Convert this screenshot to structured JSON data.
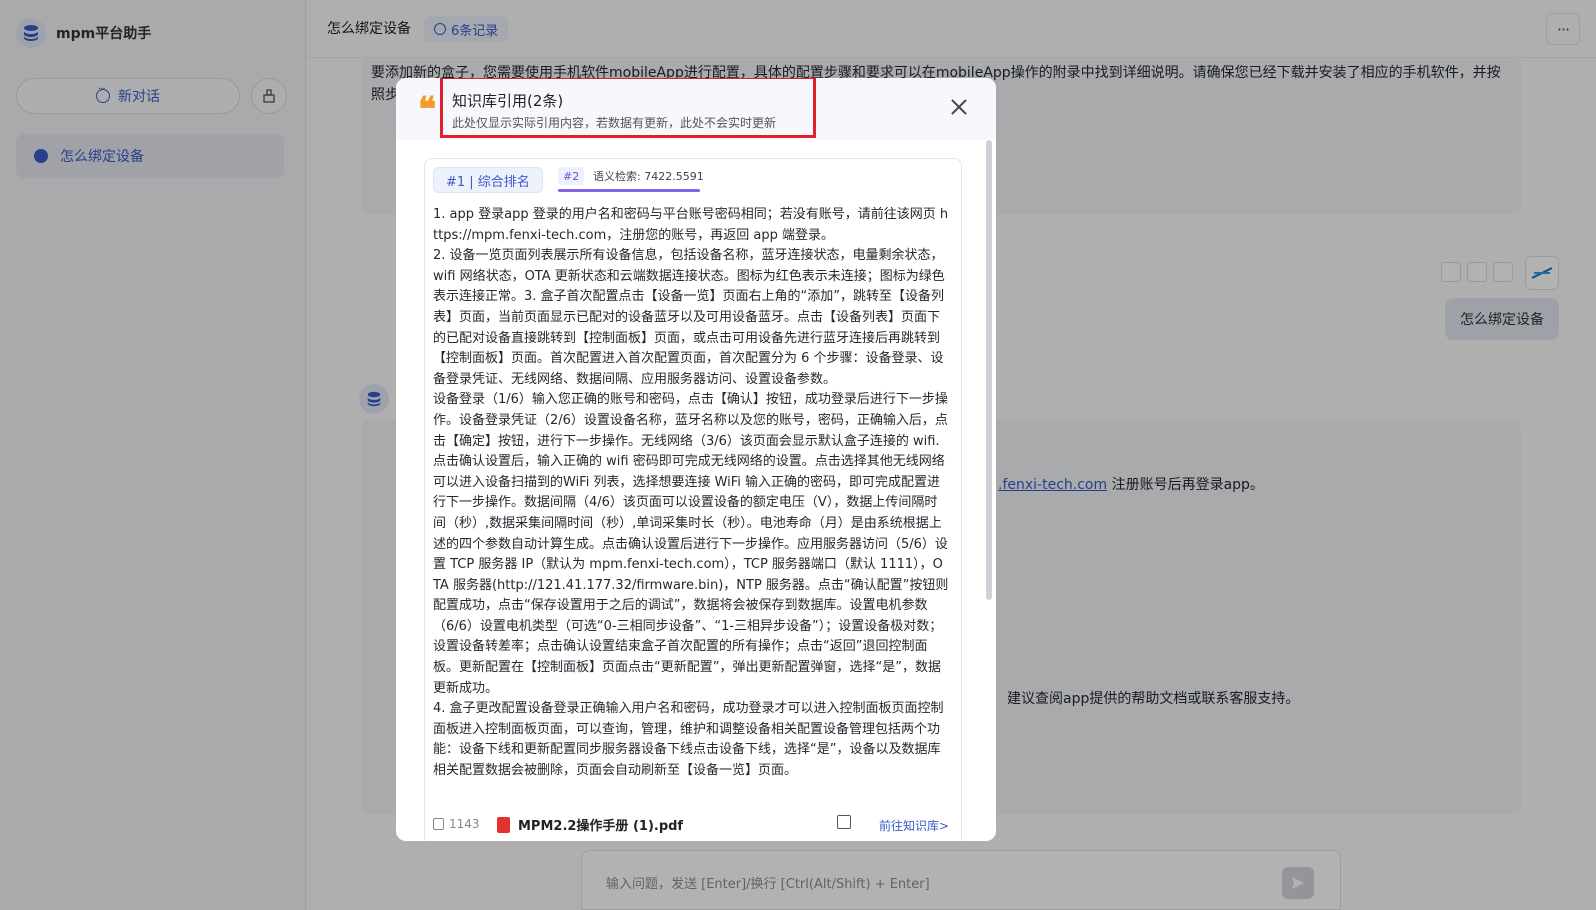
{
  "app": {
    "name": "mpm平台助手"
  },
  "sidebar": {
    "new_chat_label": "新对话",
    "history": [
      {
        "label": "怎么绑定设备"
      }
    ]
  },
  "header": {
    "title": "怎么绑定设备",
    "records_label": "6条记录",
    "more_label": "···"
  },
  "chat": {
    "bg_line1": "要添加新的盒子，您需要使用手机软件mobileApp进行配置，具体的配置步骤和要求可以在mobileApp操作的附录中找到详细说明。请确保您已经下载并安装了相应的手机软件，并按",
    "bg_line2": "照步",
    "user_message": "怎么绑定设备",
    "bg_link_text": ".fenxi-tech.com",
    "bg_after_link": "注册账号后再登录app。",
    "bg_help": "建议查阅app提供的帮助文档或联系客服支持。"
  },
  "input": {
    "placeholder": "输入问题，发送 [Enter]/换行 [Ctrl(Alt/Shift) + Enter]"
  },
  "modal": {
    "title": "知识库引用(2条)",
    "subtitle": "此处仅显示实际引用内容，若数据有更新，此处不会实时更新",
    "quote_mark": "❝",
    "reference": {
      "rank_tag": "#1 | 综合排名",
      "semantic_tag": "#2",
      "semantic_label": "语义检索: 7422.5591",
      "paragraphs": [
        "1. app 登录app 登录的用户名和密码与平台账号密码相同；若没有账号，请前往该网页 https://mpm.fenxi-tech.com，注册您的账号，再返回 app 端登录。",
        "2. 设备一览页面列表展示所有设备信息，包括设备名称，蓝牙连接状态，电量剩余状态，wifi 网络状态，OTA 更新状态和云端数据连接状态。图标为红色表示未连接；图标为绿色表示连接正常。3. 盒子首次配置点击【设备一览】页面右上角的“添加”，跳转至【设备列表】页面，当前页面显示已配对的设备蓝牙以及可用设备蓝牙。点击【设备列表】页面下的已配对设备直接跳转到【控制面板】页面，或点击可用设备先进行蓝牙连接后再跳转到【控制面板】页面。首次配置进入首次配置页面，首次配置分为 6 个步骤：设备登录、设备登录凭证、无线网络、数据间隔、应用服务器访问、设置设备参数。",
        "设备登录（1/6）输入您正确的账号和密码，点击【确认】按钮，成功登录后进行下一步操作。设备登录凭证（2/6）设置设备名称，蓝牙名称以及您的账号，密码，正确输入后，点击【确定】按钮，进行下一步操作。无线网络（3/6）该页面会显示默认盒子连接的 wifi.点击确认设置后，输入正确的 wifi 密码即可完成无线网络的设置。点击选择其他无线网络可以进入设备扫描到的WiFi 列表，选择想要连接 WiFi 输入正确的密码，即可完成配置进行下一步操作。数据间隔（4/6）该页面可以设置设备的额定电压（V），数据上传间隔时间（秒）,数据采集间隔时间（秒）,单词采集时长（秒）。电池寿命（月）是由系统根据上述的四个参数自动计算生成。点击确认设置后进行下一步操作。应用服务器访问（5/6）设置 TCP 服务器 IP（默认为 mpm.fenxi-tech.com），TCP 服务器端口（默认 1111），OTA 服务器(http://121.41.177.32/firmware.bin)，NTP 服务器。点击“确认配置”按钮则配置成功，点击“保存设置用于之后的调试”，数据将会被保存到数据库。设置电机参数（6/6）设置电机类型（可选“0-三相同步设备”、“1-三相异步设备”）；设置设备极对数；设置设备转差率；点击确认设置结束盒子首次配置的所有操作；点击“返回”退回控制面板。更新配置在【控制面板】页面点击“更新配置”，弹出更新配置弹窗，选择“是”，数据更新成功。",
        "4. 盒子更改配置设备登录正确输入用户名和密码，成功登录才可以进入控制面板页面控制面板进入控制面板页面，可以查询，管理，维护和调整设备相关配置设备管理包括两个功能：设备下线和更新配置同步服务器设备下线点击设备下线，选择“是”，设备以及数据库相关配置数据会被删除，页面会自动刷新至【设备一览】页面。"
      ],
      "char_count": "1143",
      "file_name": "MPM2.2操作手册 (1).pdf",
      "goto_label": "前往知识库>"
    }
  },
  "colors": {
    "accent": "#3a5cc9",
    "highlight_box": "#e0202f",
    "quote": "#f39a2f",
    "semantic_bar": "#8364e8"
  }
}
